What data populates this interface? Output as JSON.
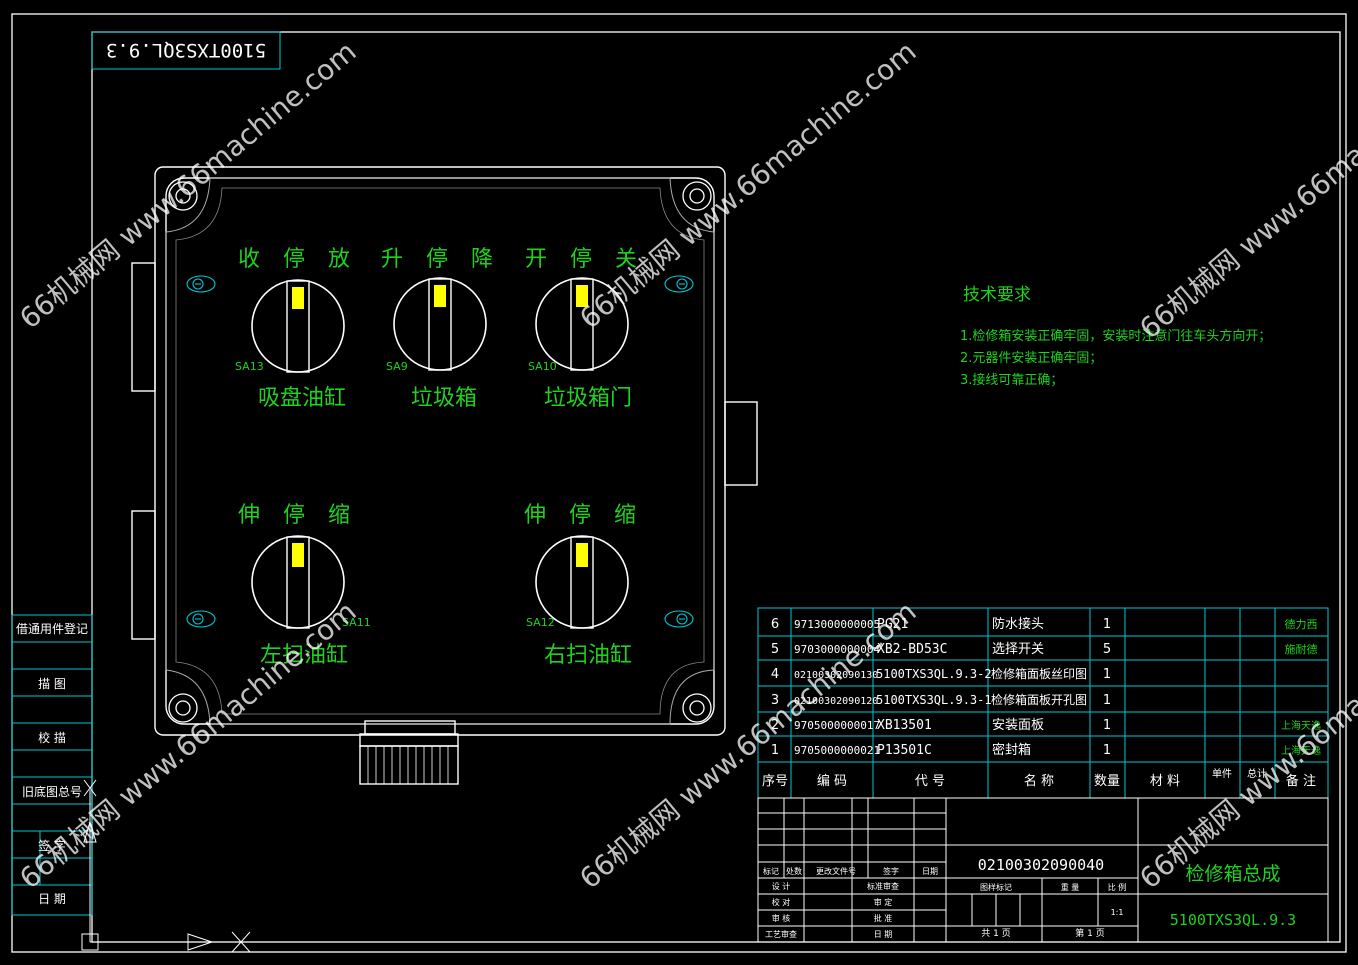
{
  "colors": {
    "background": "#000000",
    "frame": "#ffffff",
    "table_line": "#00c8d2",
    "label_green": "#1ed21e",
    "text_white": "#ffffff",
    "indicator_yellow": "#ffff00",
    "watermark": "#ffffff"
  },
  "drawing_code_mirrored": "5100TXS3QL.9.3",
  "switches": [
    {
      "id": "SA13",
      "positions": "收 停 放",
      "caption": "吸盘油缸"
    },
    {
      "id": "SA9",
      "positions": "升 停 降",
      "caption": "垃圾箱"
    },
    {
      "id": "SA10",
      "positions": "开 停 关",
      "caption": "垃圾箱门"
    },
    {
      "id": "SA11",
      "positions": "伸 停 缩",
      "caption": "左扫油缸"
    },
    {
      "id": "SA12",
      "positions": "伸 停 缩",
      "caption": "右扫油缸"
    }
  ],
  "tech_requirements": {
    "title": "技术要求",
    "items": [
      "1.检修箱安装正确牢固，安装时注意门往车头方向开；",
      "2.元器件安装正确牢固；",
      "3.接线可靠正确；"
    ]
  },
  "bom": {
    "header": [
      "序号",
      "编  码",
      "代  号",
      "名  称",
      "数量",
      "材  料",
      "单件",
      "总计",
      "备 注"
    ],
    "rows": [
      [
        "6",
        "9713000000005",
        "PG21",
        "防水接头",
        "1",
        "",
        "",
        "",
        "德力西"
      ],
      [
        "5",
        "9703000000004",
        "XB2-BD53C",
        "选择开关",
        "5",
        "",
        "",
        "",
        "施耐德"
      ],
      [
        "4",
        "02100302090130",
        "5100TXS3QL.9.3-2",
        "检修箱面板丝印图",
        "1",
        "",
        "",
        "",
        ""
      ],
      [
        "3",
        "02100302090120",
        "5100TXS3QL.9.3-1",
        "检修箱面板开孔图",
        "1",
        "",
        "",
        "",
        ""
      ],
      [
        "2",
        "9705000000017",
        "XB13501",
        "安装面板",
        "1",
        "",
        "",
        "",
        "上海天逸"
      ],
      [
        "1",
        "9705000000021",
        "P13501C",
        "密封箱",
        "1",
        "",
        "",
        "",
        "上海天逸"
      ]
    ]
  },
  "title_block": {
    "drawing_number": "02100302090040",
    "title": "检修箱总成",
    "code": "5100TXS3QL.9.3",
    "rev_labels": [
      "标记",
      "处数",
      "更改文件号",
      "签字",
      "日期"
    ],
    "role_labels_left": [
      "设 计",
      "校 对",
      "审 核",
      "工艺审查"
    ],
    "role_labels_mid": [
      "标准审查",
      "审 定",
      "批 准",
      "日 期"
    ],
    "stage_label": "图样标记",
    "weight_label": "重 量",
    "scale_label": "比 例",
    "scale_value": "1:1",
    "sheets_total": "共 1 页",
    "sheet_current": "第 1 页"
  },
  "side_block": [
    "借通用件登记",
    "描 图",
    "校 描",
    "旧底图总号",
    "签 字",
    "日 期"
  ],
  "watermark_text": "66机械网 www.66machine.com"
}
